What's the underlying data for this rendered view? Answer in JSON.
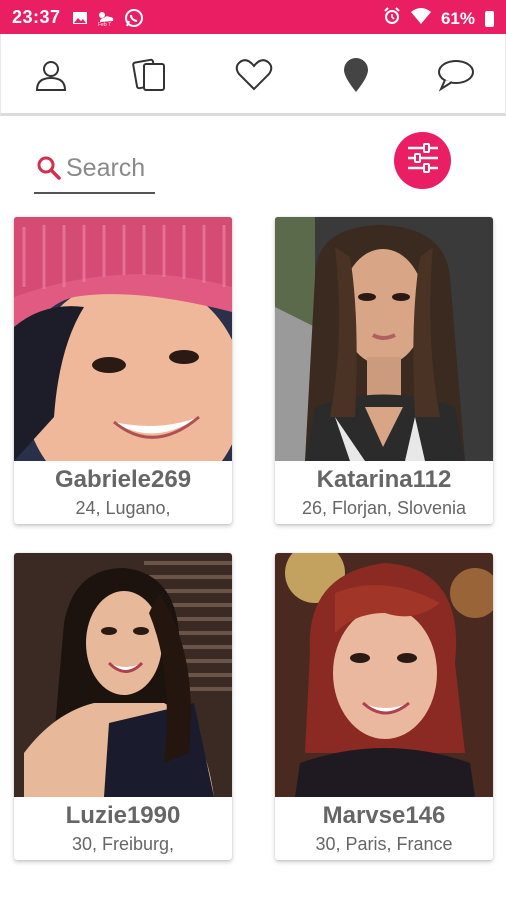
{
  "status_bar": {
    "time": "23:37",
    "battery": "61%",
    "notification_icons": [
      "image-icon",
      "weather-icon",
      "whatsapp-icon"
    ],
    "system_icons": [
      "alarm-icon",
      "wifi-icon",
      "battery-icon"
    ]
  },
  "nav": {
    "items": [
      "profile-icon",
      "cards-icon",
      "heart-icon",
      "location-icon",
      "chat-icon"
    ]
  },
  "search": {
    "placeholder": "Search"
  },
  "colors": {
    "accent": "#e91e63",
    "text_gray": "#666666"
  },
  "profiles": [
    {
      "name": "Gabriele269",
      "meta": "24, Lugano,"
    },
    {
      "name": "Katarina112",
      "meta": "26, Florjan, Slovenia"
    },
    {
      "name": "Luzie1990",
      "meta": "30, Freiburg,"
    },
    {
      "name": "Marvse146",
      "meta": "30, Paris, France"
    }
  ]
}
